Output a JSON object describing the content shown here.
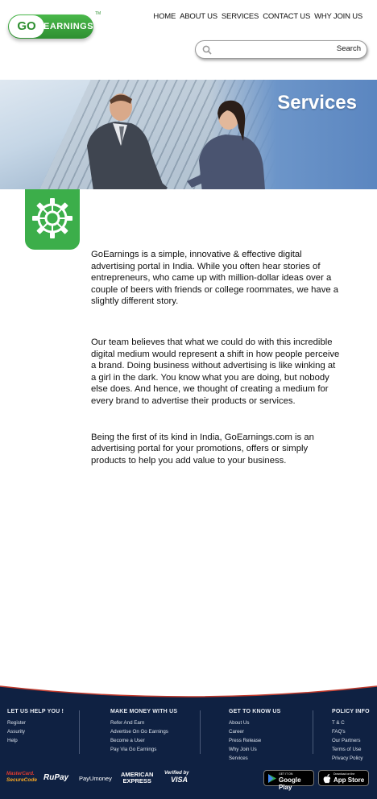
{
  "brand": {
    "logo_go": "GO",
    "logo_rest": "EARNINGS",
    "trademark": "TM"
  },
  "nav": {
    "items": [
      "HOME",
      "ABOUT US",
      "SERVICES",
      "CONTACT US",
      "WHY JOIN US"
    ]
  },
  "search": {
    "button_label": "Search",
    "value": ""
  },
  "hero": {
    "title": "Services"
  },
  "content": {
    "paragraphs": [
      "GoEarnings is a simple, innovative & effective digital advertising portal in India. While you often hear stories of entrepreneurs, who came up with million-dollar ideas over a couple of beers with friends or college roommates, we have a slightly different story.",
      "Our team believes that what we could do with this incredible digital medium would represent a shift in how people perceive a brand. Doing business without advertising is like winking at a girl in the dark. You know what you are doing, but nobody else does. And hence, we thought of creating a medium for every brand to advertise their products or services.",
      "Being the first of its kind in India, GoEarnings.com is an advertising portal for your promotions, offers or simply products to help you add value to your business."
    ]
  },
  "footer": {
    "col1": {
      "title": "LET US HELP YOU !",
      "links": [
        "Register",
        "Assurity",
        "Help"
      ]
    },
    "col2": {
      "title": "MAKE MONEY WITH US",
      "links": [
        "Refer And Earn",
        "Advertise On Go Earnings",
        "Become a User",
        "Pay Via Go Earnings"
      ]
    },
    "col3": {
      "title": "GET TO KNOW US",
      "links": [
        "About Us",
        "Career",
        "Press Release",
        "Why Join Us",
        "Services"
      ]
    },
    "col4": {
      "title": "POLICY INFO",
      "links": [
        "T & C",
        "FAQ's",
        "Our Partners",
        "Terms of Use",
        "Privacy Policy"
      ]
    },
    "payments": {
      "mastercard_top": "MasterCard.",
      "mastercard_bottom": "SecureCode",
      "rupay": "RuPay",
      "payu": "PayUmoney",
      "amex_top": "AMERICAN",
      "amex_bottom": "EXPRESS",
      "visa_top": "Verified by",
      "visa_bottom": "VISA"
    },
    "stores": {
      "google_small": "GET IT ON",
      "google_big": "Google Play",
      "apple_small": "Download on the",
      "apple_big": "App Store"
    }
  },
  "colors": {
    "brand_green": "#3cae4a",
    "footer_navy": "#0f2142",
    "footer_accent_red": "#c0392b"
  }
}
